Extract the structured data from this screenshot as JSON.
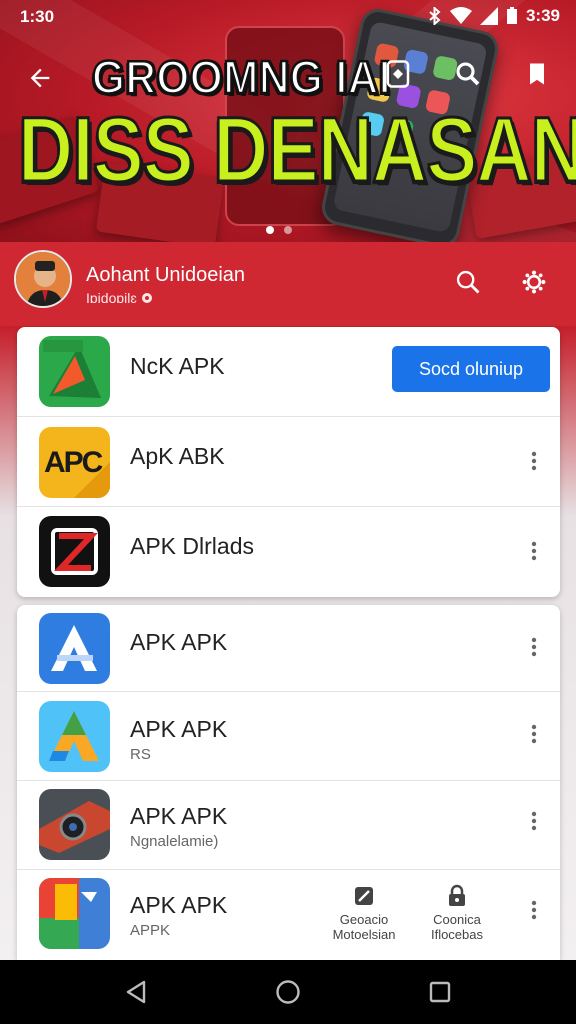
{
  "status_bar": {
    "time": "1:30",
    "time_right": "3:39"
  },
  "hero": {
    "title_line1": "GROOMNG IAI",
    "title_line2": "DISS DENASAN",
    "colors": {
      "title_line2": "#c8ef1e",
      "background": "#c8202c"
    }
  },
  "channel": {
    "name": "Aohant Unidoeian",
    "subtitle": "Iɒidoɒilɛ"
  },
  "card1": {
    "items": [
      {
        "title": "NcK APK",
        "button_label": "Socd oluniup",
        "icon": "nck-app-icon"
      },
      {
        "title": "ApK ABK",
        "icon": "apc-app-icon",
        "icon_text": "APC"
      },
      {
        "title": "APK Dlrlads",
        "icon": "z-app-icon"
      }
    ]
  },
  "card2": {
    "items": [
      {
        "title": "APK APK",
        "subtitle": "",
        "icon": "blue-a-app-icon"
      },
      {
        "title": "APK APK",
        "subtitle": "RS",
        "icon": "gradient-a-app-icon"
      },
      {
        "title": "APK APK",
        "subtitle": "Ngnalelamie)",
        "icon": "camera-app-icon"
      },
      {
        "title": "APK APK",
        "subtitle": "APPK",
        "icon": "flag-app-icon",
        "actions": [
          {
            "label_line1": "Geoacio",
            "label_line2": "Motoelsian",
            "icon": "edit-icon"
          },
          {
            "label_line1": "Coonica",
            "label_line2": "Iflocebas",
            "icon": "lock-icon"
          }
        ]
      }
    ]
  },
  "theme": {
    "accent": "#1a73e8",
    "brand_red": "#d02833"
  }
}
